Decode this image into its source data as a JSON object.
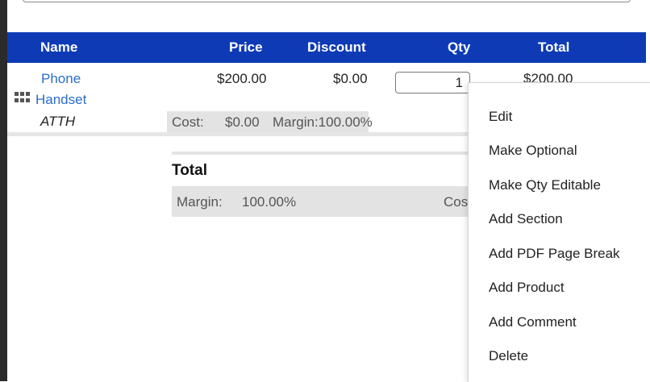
{
  "table": {
    "headers": {
      "name": "Name",
      "price": "Price",
      "discount": "Discount",
      "qty": "Qty",
      "total": "Total"
    },
    "row": {
      "name_line1": "Phone",
      "name_line2": "Handset",
      "description": "ATTH",
      "price": "$200.00",
      "discount": "$0.00",
      "qty": "1",
      "total": "$200.00",
      "cost_label": "Cost:",
      "cost_value": "$0.00",
      "margin_text": "Margin:100.00%"
    }
  },
  "summary": {
    "title": "Total",
    "margin_label": "Margin:",
    "margin_value": "100.00%",
    "cost_label": "Cos"
  },
  "context_menu": {
    "items": [
      "Edit",
      "Make Optional",
      "Make Qty Editable",
      "Add Section",
      "Add PDF Page Break",
      "Add Product",
      "Add Comment",
      "Delete"
    ]
  },
  "colors": {
    "header_bg": "#0e3bb5",
    "link": "#2a6cc9",
    "band": "#e3e3e3"
  },
  "icons": {
    "drag_handle": "grip-icon"
  }
}
